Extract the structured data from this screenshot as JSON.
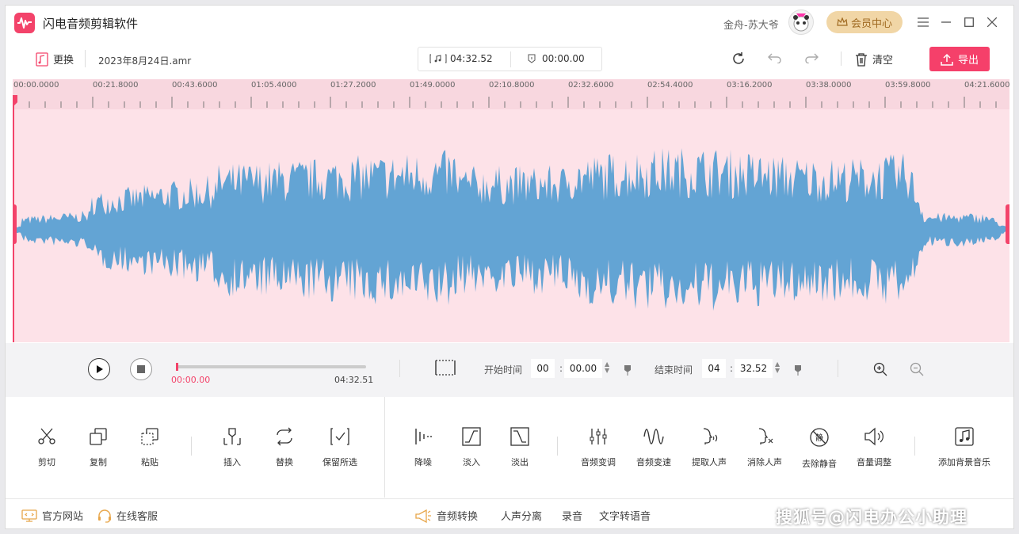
{
  "app": {
    "title": "闪电音频剪辑软件",
    "user_name": "金舟-苏大爷",
    "vip_label": "会员中心"
  },
  "toolbar": {
    "replace_label": "更换",
    "file_name": "2023年8月24日.amr",
    "total_duration": "04:32.52",
    "cursor_time": "00:00.00",
    "clear_label": "清空",
    "export_label": "导出"
  },
  "ruler": {
    "labels": [
      "00:00.0000",
      "00:21.8000",
      "00:43.6000",
      "01:05.4000",
      "01:27.2000",
      "01:49.0000",
      "02:10.8000",
      "02:32.6000",
      "02:54.4000",
      "03:16.2000",
      "03:38.0000",
      "03:59.8000",
      "04:21.6000"
    ]
  },
  "playback": {
    "current": "00:00.00",
    "total": "04:32.51",
    "progress": 0.0,
    "start_label": "开始时间",
    "start_min": "00",
    "start_sec": "00.00",
    "end_label": "结束时间",
    "end_min": "04",
    "end_sec": "32.52"
  },
  "tools": {
    "cut": "剪切",
    "copy": "复制",
    "paste": "粘贴",
    "insert": "插入",
    "replace": "替换",
    "keep": "保留所选",
    "denoise": "降噪",
    "fade_in": "淡入",
    "fade_out": "淡出",
    "pitch": "音频变调",
    "speed": "音频变速",
    "extract_voice": "提取人声",
    "remove_voice": "消除人声",
    "remove_silence": "去除静音",
    "volume": "音量调整",
    "add_bgm": "添加背景音乐"
  },
  "footer": {
    "website": "官方网站",
    "support": "在线客服",
    "convert": "音频转换",
    "separate": "人声分离",
    "record": "录音",
    "tts": "文字转语音"
  },
  "watermark": "搜狐号@闪电办公小助理",
  "colors": {
    "accent": "#f3436a",
    "waveform": "#63a4d4",
    "wave_bg": "#fde2e8",
    "vip_bg": "#f1d6a6"
  }
}
